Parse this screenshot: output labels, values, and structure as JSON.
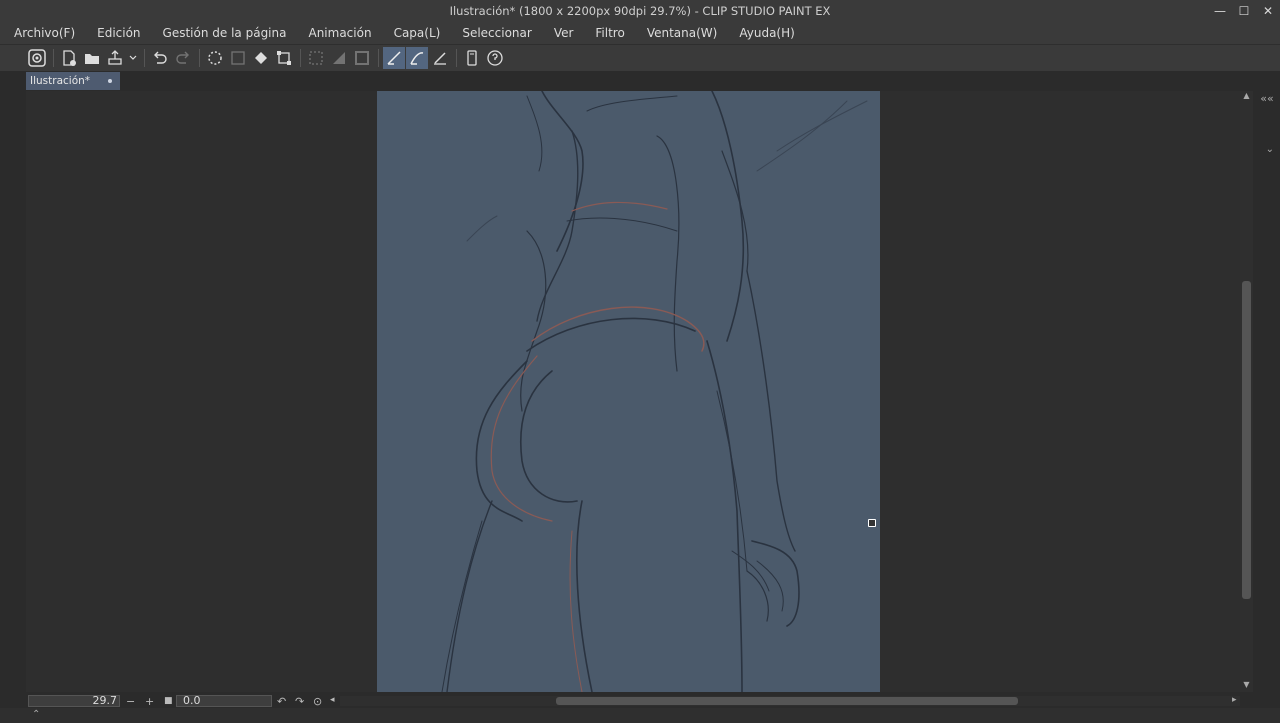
{
  "window": {
    "title": "Ilustración* (1800 x 2200px 90dpi 29.7%)  - CLIP STUDIO PAINT EX",
    "controls": [
      "—",
      "☐",
      "✕"
    ]
  },
  "menu": [
    "Archivo(F)",
    "Edición",
    "Gestión de la página",
    "Animación",
    "Capa(L)",
    "Seleccionar",
    "Ver",
    "Filtro",
    "Ventana(W)",
    "Ayuda(H)"
  ],
  "tabs": {
    "active_label": "Ilustración*"
  },
  "status": {
    "zoom": "29.7",
    "rotation": "0.0",
    "zoom_out": "−",
    "zoom_in": "+"
  },
  "colors": {
    "canvas": "#4b5a6b",
    "accent": "#536680",
    "sketch_dark": "#2a3340",
    "sketch_red": "#8a5a55"
  }
}
